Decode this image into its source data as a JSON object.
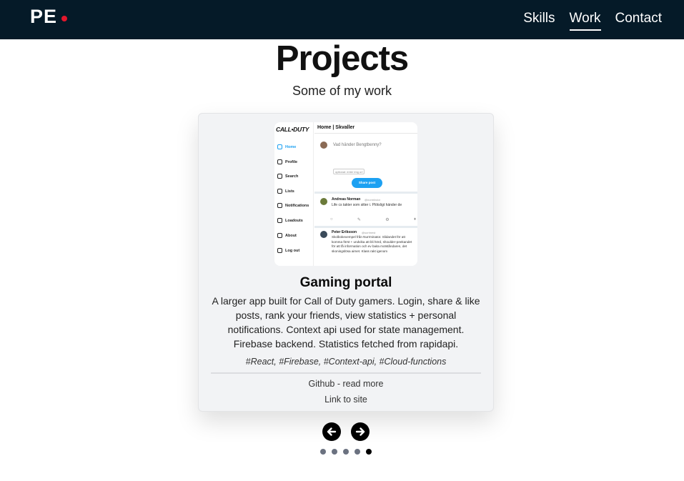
{
  "nav": {
    "logo": "PE",
    "links": [
      {
        "label": "Skills",
        "active": false
      },
      {
        "label": "Work",
        "active": true
      },
      {
        "label": "Contact",
        "active": false
      }
    ]
  },
  "page": {
    "title": "Projects",
    "subtitle": "Some of my work"
  },
  "project": {
    "title": "Gaming portal",
    "description": "A larger app built for Call of Duty gamers. Login, share & like posts, rank your friends, view statistics + personal notifications. Context api used for state management. Firebase backend. Statistics fetched from rapidapi.",
    "tags": "#React, #Firebase, #Context-api, #Cloud-functions",
    "github_link": "Github - read more",
    "site_link": "Link to site",
    "screenshot": {
      "logo": "CALL•DUTY",
      "header": "Home | Skvaller",
      "nav": [
        "Home",
        "Profile",
        "Search",
        "Lists",
        "Notifications",
        "Loadouts",
        "About",
        "Log out"
      ],
      "prompt": "Vad händer Bengtbenny?",
      "input_placeholder": "optional: enter img url",
      "share_button": "Share post",
      "post1_author": "Andreas Norman",
      "post1_handle": "@normlndor",
      "post1_text": "Life cs takter som sitter i. Plötsligt händer de",
      "post2_author": "Peter Eriksson",
      "post2_handle": "@sortmest",
      "post2_text": "Skolbokexempel från Nurrminator. Slidandet för att komma först + undvika att bli hörd, shoulder-peekandet för att få information och ev baita motståndaren, det skoningslösa aimet. Klass rakt igenom"
    }
  },
  "carousel": {
    "total": 5,
    "active_index": 4
  },
  "colors": {
    "navbar": "#051a28",
    "accent_dot": "#e3172c",
    "card_bg": "#f2f3f5",
    "dot_inactive": "#6b7280",
    "dot_active": "#000000",
    "screenshot_accent": "#1da1f2"
  }
}
